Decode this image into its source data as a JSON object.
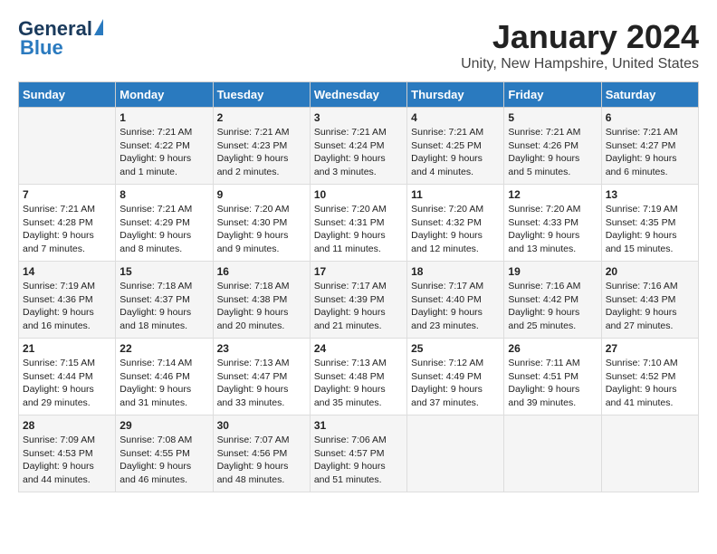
{
  "header": {
    "logo_line1": "General",
    "logo_line2": "Blue",
    "month": "January 2024",
    "location": "Unity, New Hampshire, United States"
  },
  "weekdays": [
    "Sunday",
    "Monday",
    "Tuesday",
    "Wednesday",
    "Thursday",
    "Friday",
    "Saturday"
  ],
  "weeks": [
    [
      {
        "day": "",
        "content": ""
      },
      {
        "day": "1",
        "content": "Sunrise: 7:21 AM\nSunset: 4:22 PM\nDaylight: 9 hours\nand 1 minute."
      },
      {
        "day": "2",
        "content": "Sunrise: 7:21 AM\nSunset: 4:23 PM\nDaylight: 9 hours\nand 2 minutes."
      },
      {
        "day": "3",
        "content": "Sunrise: 7:21 AM\nSunset: 4:24 PM\nDaylight: 9 hours\nand 3 minutes."
      },
      {
        "day": "4",
        "content": "Sunrise: 7:21 AM\nSunset: 4:25 PM\nDaylight: 9 hours\nand 4 minutes."
      },
      {
        "day": "5",
        "content": "Sunrise: 7:21 AM\nSunset: 4:26 PM\nDaylight: 9 hours\nand 5 minutes."
      },
      {
        "day": "6",
        "content": "Sunrise: 7:21 AM\nSunset: 4:27 PM\nDaylight: 9 hours\nand 6 minutes."
      }
    ],
    [
      {
        "day": "7",
        "content": "Sunrise: 7:21 AM\nSunset: 4:28 PM\nDaylight: 9 hours\nand 7 minutes."
      },
      {
        "day": "8",
        "content": "Sunrise: 7:21 AM\nSunset: 4:29 PM\nDaylight: 9 hours\nand 8 minutes."
      },
      {
        "day": "9",
        "content": "Sunrise: 7:20 AM\nSunset: 4:30 PM\nDaylight: 9 hours\nand 9 minutes."
      },
      {
        "day": "10",
        "content": "Sunrise: 7:20 AM\nSunset: 4:31 PM\nDaylight: 9 hours\nand 11 minutes."
      },
      {
        "day": "11",
        "content": "Sunrise: 7:20 AM\nSunset: 4:32 PM\nDaylight: 9 hours\nand 12 minutes."
      },
      {
        "day": "12",
        "content": "Sunrise: 7:20 AM\nSunset: 4:33 PM\nDaylight: 9 hours\nand 13 minutes."
      },
      {
        "day": "13",
        "content": "Sunrise: 7:19 AM\nSunset: 4:35 PM\nDaylight: 9 hours\nand 15 minutes."
      }
    ],
    [
      {
        "day": "14",
        "content": "Sunrise: 7:19 AM\nSunset: 4:36 PM\nDaylight: 9 hours\nand 16 minutes."
      },
      {
        "day": "15",
        "content": "Sunrise: 7:18 AM\nSunset: 4:37 PM\nDaylight: 9 hours\nand 18 minutes."
      },
      {
        "day": "16",
        "content": "Sunrise: 7:18 AM\nSunset: 4:38 PM\nDaylight: 9 hours\nand 20 minutes."
      },
      {
        "day": "17",
        "content": "Sunrise: 7:17 AM\nSunset: 4:39 PM\nDaylight: 9 hours\nand 21 minutes."
      },
      {
        "day": "18",
        "content": "Sunrise: 7:17 AM\nSunset: 4:40 PM\nDaylight: 9 hours\nand 23 minutes."
      },
      {
        "day": "19",
        "content": "Sunrise: 7:16 AM\nSunset: 4:42 PM\nDaylight: 9 hours\nand 25 minutes."
      },
      {
        "day": "20",
        "content": "Sunrise: 7:16 AM\nSunset: 4:43 PM\nDaylight: 9 hours\nand 27 minutes."
      }
    ],
    [
      {
        "day": "21",
        "content": "Sunrise: 7:15 AM\nSunset: 4:44 PM\nDaylight: 9 hours\nand 29 minutes."
      },
      {
        "day": "22",
        "content": "Sunrise: 7:14 AM\nSunset: 4:46 PM\nDaylight: 9 hours\nand 31 minutes."
      },
      {
        "day": "23",
        "content": "Sunrise: 7:13 AM\nSunset: 4:47 PM\nDaylight: 9 hours\nand 33 minutes."
      },
      {
        "day": "24",
        "content": "Sunrise: 7:13 AM\nSunset: 4:48 PM\nDaylight: 9 hours\nand 35 minutes."
      },
      {
        "day": "25",
        "content": "Sunrise: 7:12 AM\nSunset: 4:49 PM\nDaylight: 9 hours\nand 37 minutes."
      },
      {
        "day": "26",
        "content": "Sunrise: 7:11 AM\nSunset: 4:51 PM\nDaylight: 9 hours\nand 39 minutes."
      },
      {
        "day": "27",
        "content": "Sunrise: 7:10 AM\nSunset: 4:52 PM\nDaylight: 9 hours\nand 41 minutes."
      }
    ],
    [
      {
        "day": "28",
        "content": "Sunrise: 7:09 AM\nSunset: 4:53 PM\nDaylight: 9 hours\nand 44 minutes."
      },
      {
        "day": "29",
        "content": "Sunrise: 7:08 AM\nSunset: 4:55 PM\nDaylight: 9 hours\nand 46 minutes."
      },
      {
        "day": "30",
        "content": "Sunrise: 7:07 AM\nSunset: 4:56 PM\nDaylight: 9 hours\nand 48 minutes."
      },
      {
        "day": "31",
        "content": "Sunrise: 7:06 AM\nSunset: 4:57 PM\nDaylight: 9 hours\nand 51 minutes."
      },
      {
        "day": "",
        "content": ""
      },
      {
        "day": "",
        "content": ""
      },
      {
        "day": "",
        "content": ""
      }
    ]
  ]
}
